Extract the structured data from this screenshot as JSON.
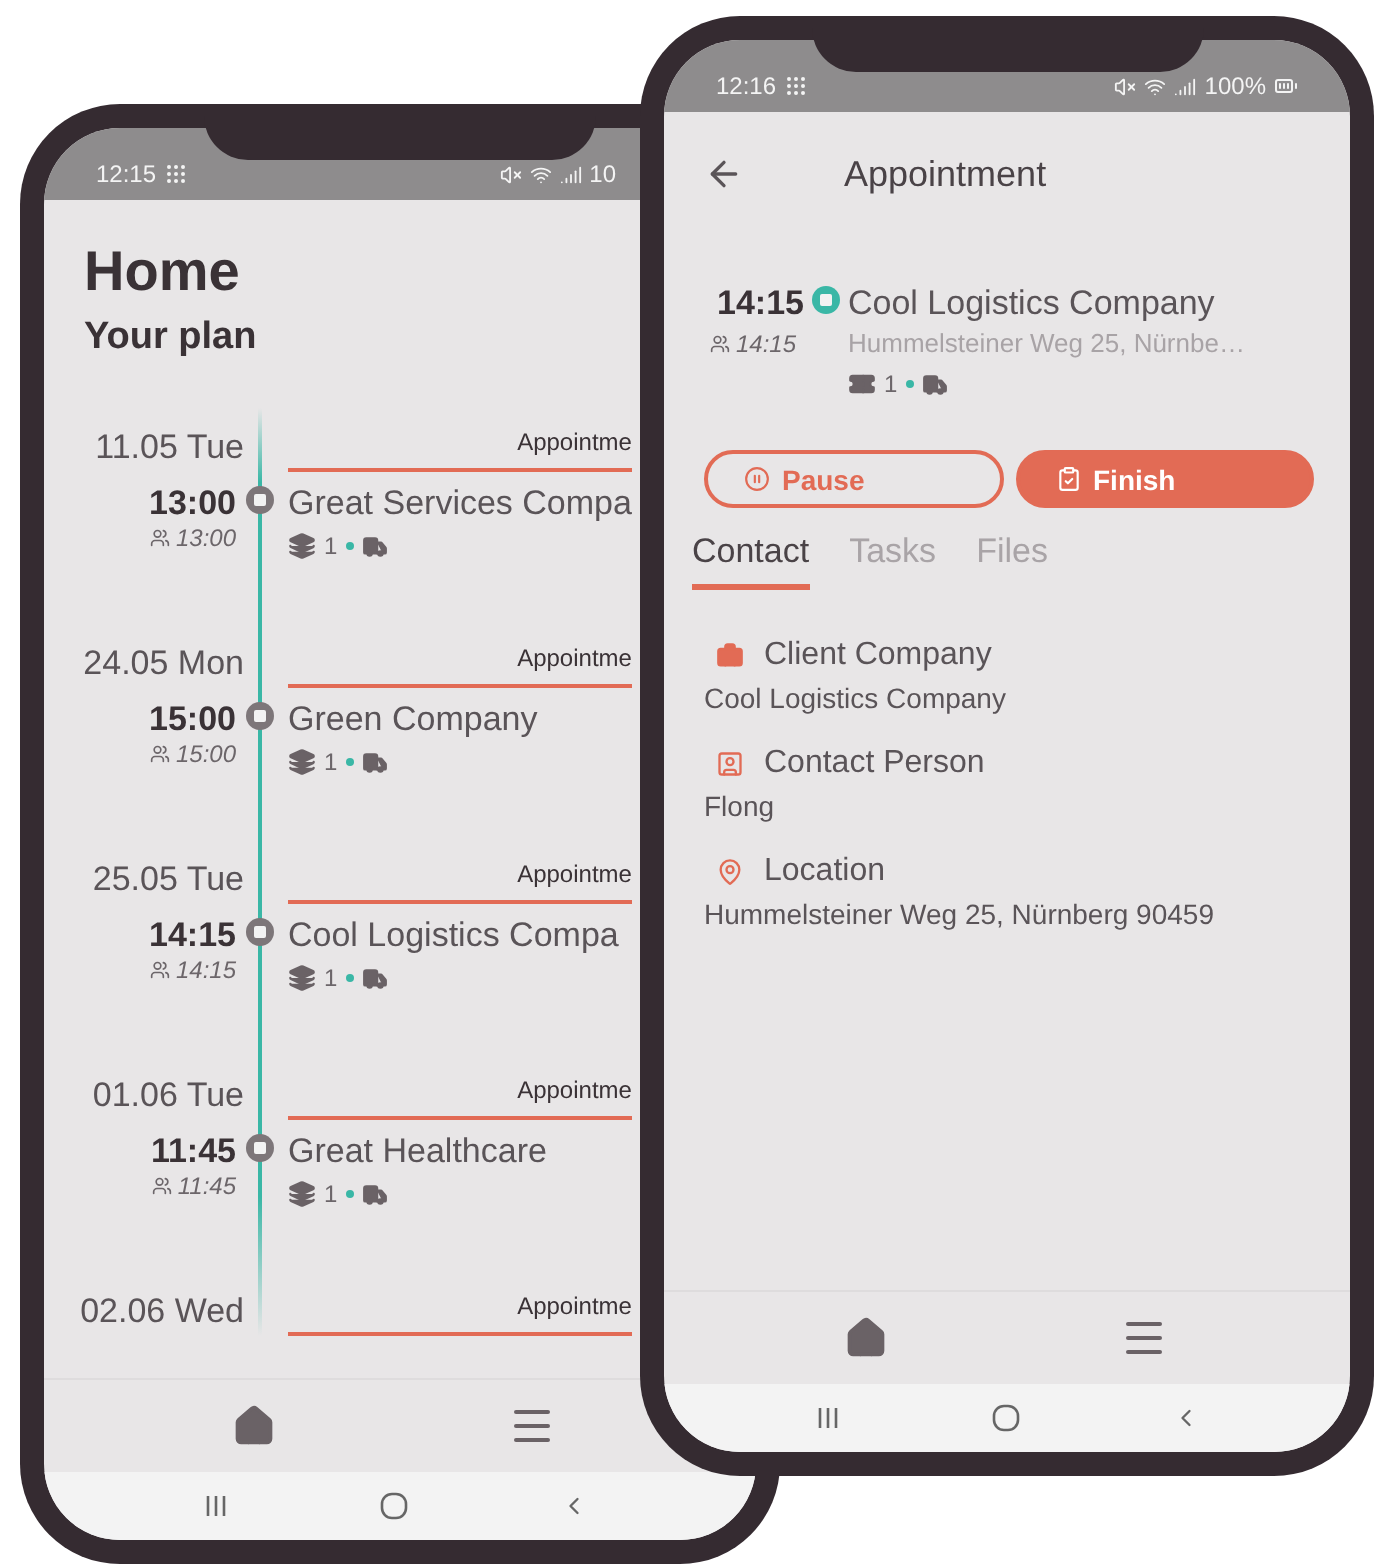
{
  "home_screen": {
    "status_bar": {
      "time": "12:15",
      "battery": "10"
    },
    "title": "Home",
    "subtitle": "Your plan",
    "days": [
      {
        "date": "11.05 Tue",
        "type": "Appointme",
        "time": "13:00",
        "planned_time": "13:00",
        "company": "Great Services Compa",
        "count": "1",
        "started": false
      },
      {
        "date": "24.05 Mon",
        "type": "Appointme",
        "time": "15:00",
        "planned_time": "15:00",
        "company": "Green Company",
        "count": "1",
        "started": false
      },
      {
        "date": "25.05 Tue",
        "type": "Appointme",
        "time": "14:15",
        "planned_time": "14:15",
        "company": "Cool Logistics Compa",
        "count": "1",
        "started": false
      },
      {
        "date": "01.06 Tue",
        "type": "Appointme",
        "time": "11:45",
        "planned_time": "11:45",
        "company": "Great Healthcare",
        "count": "1",
        "started": false
      },
      {
        "date": "02.06 Wed",
        "type": "Appointme"
      }
    ]
  },
  "appointment_screen": {
    "status_bar": {
      "time": "12:16",
      "battery": "100%"
    },
    "title": "Appointment",
    "appointment": {
      "time": "14:15",
      "planned_time": "14:15",
      "company": "Cool Logistics Company",
      "address": "Hummelsteiner Weg 25, Nürnbe…",
      "count": "1",
      "started": true
    },
    "buttons": [
      {
        "kind": "pause",
        "label": "Pause"
      },
      {
        "kind": "finish",
        "label": "Finish"
      }
    ],
    "tabs": [
      {
        "label": "Contact",
        "selected": true
      },
      {
        "label": "Tasks",
        "selected": false
      },
      {
        "label": "Files",
        "selected": false
      }
    ],
    "details": [
      {
        "kind": "company",
        "label": "Client Company",
        "value": "Cool Logistics Company"
      },
      {
        "kind": "person",
        "label": "Contact Person",
        "value": "Flong"
      },
      {
        "kind": "location",
        "label": "Location",
        "value": "Hummelsteiner Weg 25, Nürnberg 90459"
      }
    ]
  }
}
